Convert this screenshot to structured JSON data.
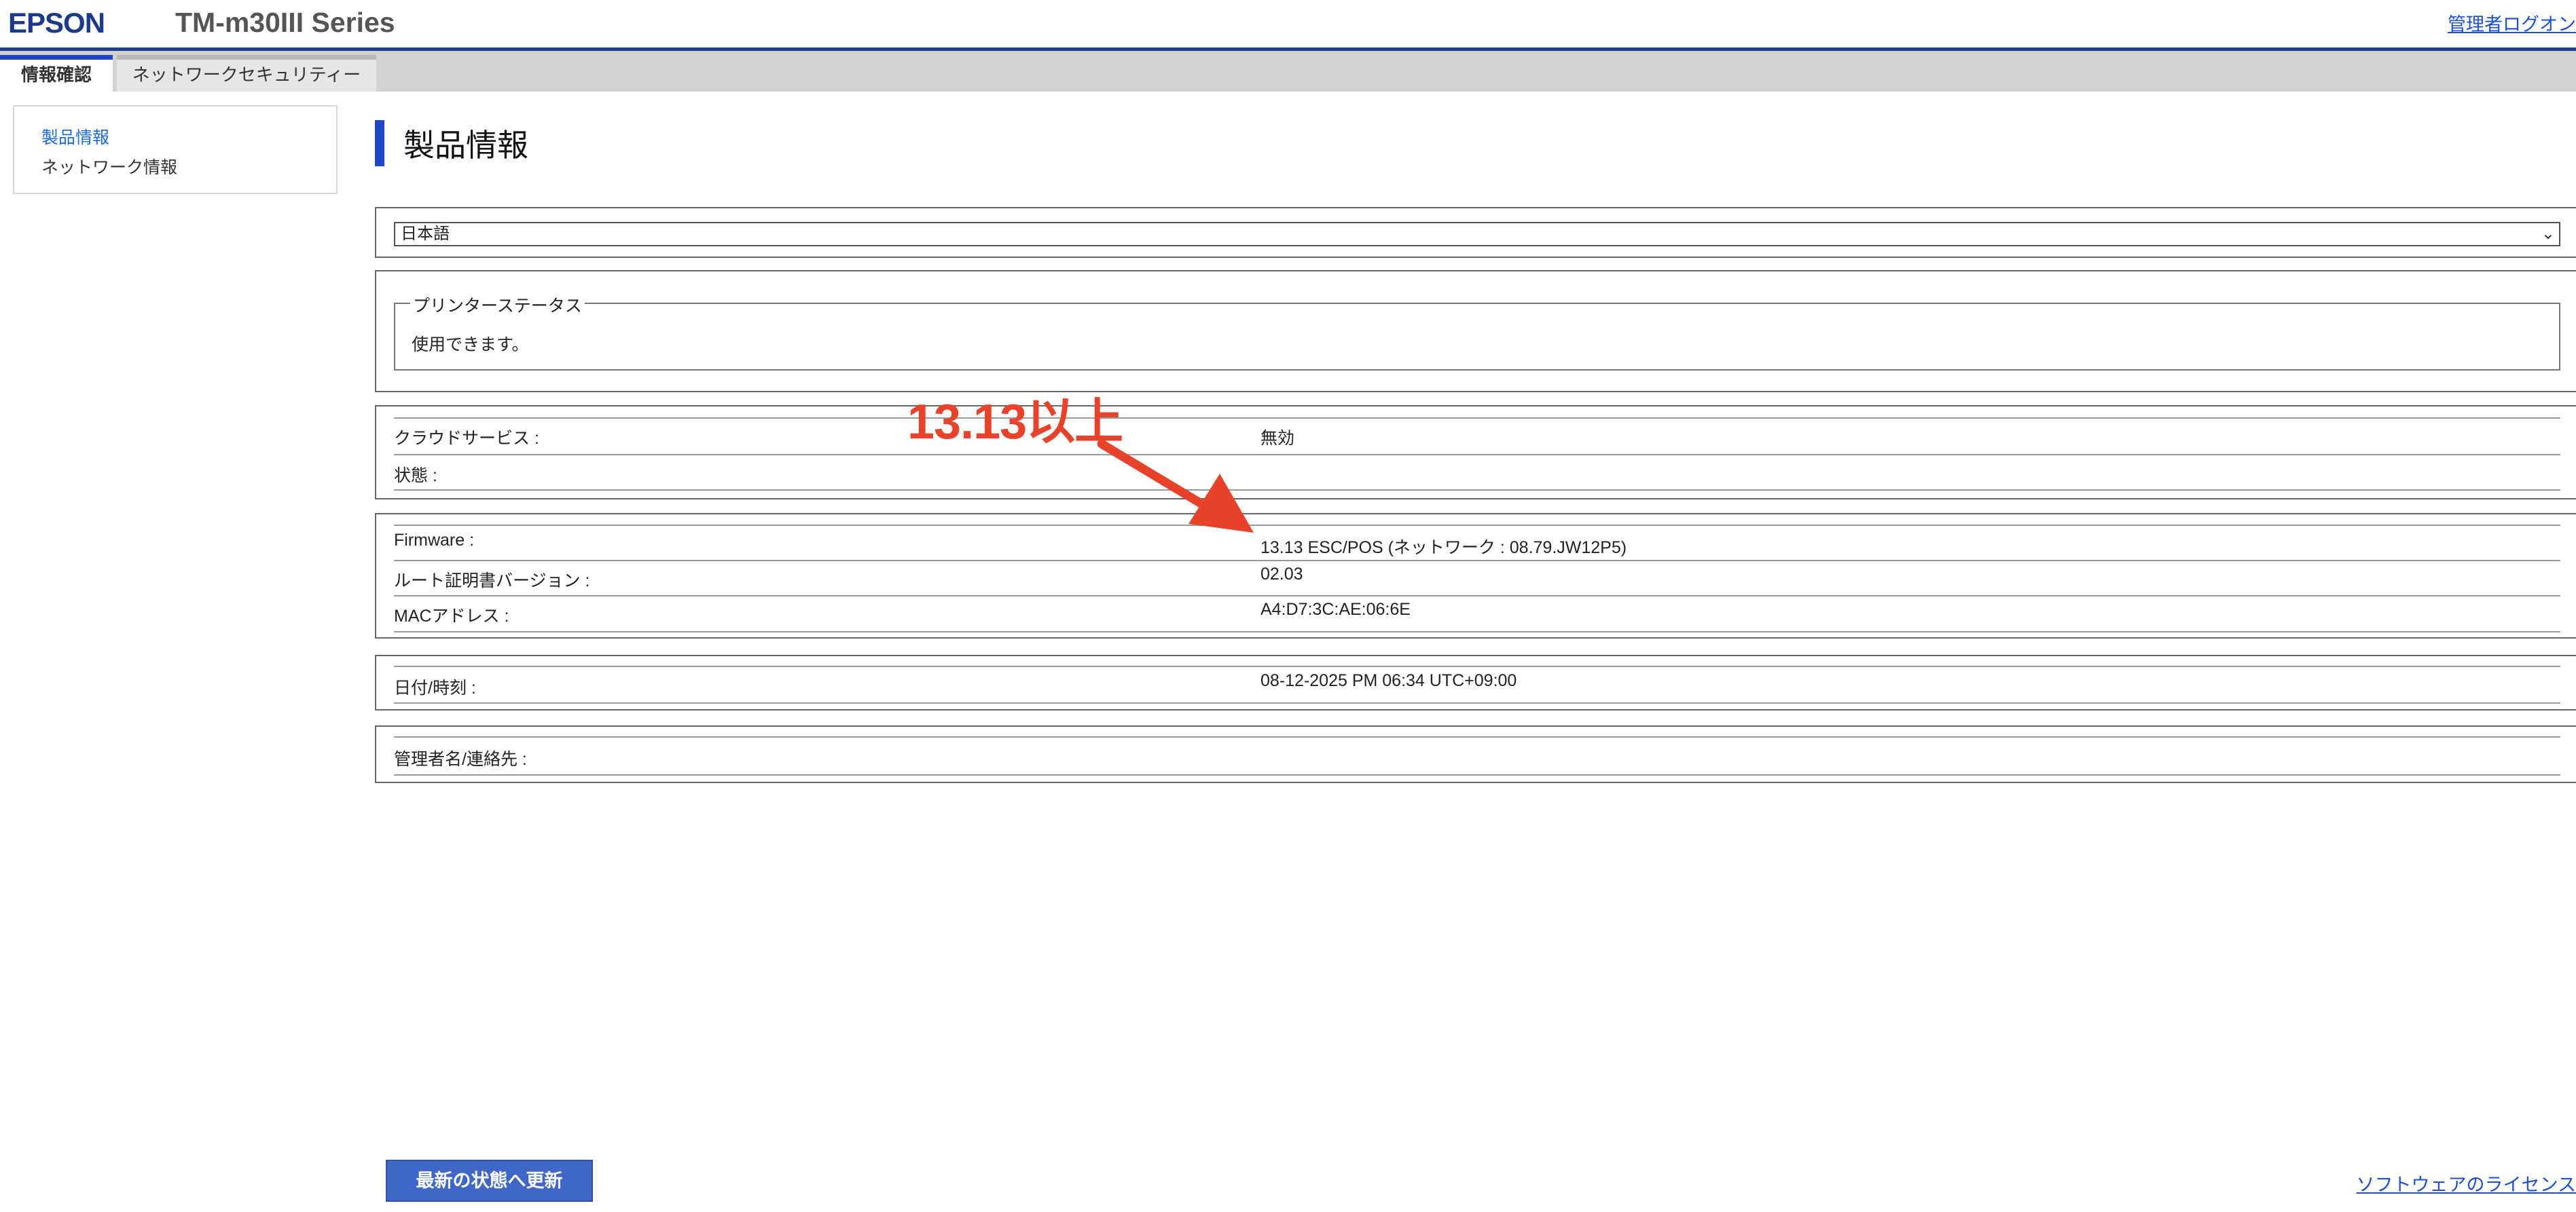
{
  "header": {
    "logo": "EPSON",
    "model": "TM-m30III Series",
    "logout_label": "管理者ログオン"
  },
  "tabs": [
    {
      "label": "情報確認",
      "active": true
    },
    {
      "label": "ネットワークセキュリティー",
      "active": false
    }
  ],
  "sidebar": {
    "items": [
      {
        "label": "製品情報",
        "active": true
      },
      {
        "label": "ネットワーク情報",
        "active": false
      }
    ]
  },
  "page": {
    "title": "製品情報",
    "language": "日本語"
  },
  "printer_status": {
    "legend": "プリンターステータス",
    "text": "使用できます。"
  },
  "cloud": {
    "rows": [
      {
        "label": "クラウドサービス :",
        "value": "無効"
      },
      {
        "label": "状態 :",
        "value": ""
      }
    ]
  },
  "device": {
    "rows": [
      {
        "label": "Firmware :",
        "value": "13.13 ESC/POS (ネットワーク : 08.79.JW12P5)"
      },
      {
        "label": "ルート証明書バージョン :",
        "value": "02.03"
      },
      {
        "label": "MACアドレス :",
        "value": "A4:D7:3C:AE:06:6E"
      }
    ]
  },
  "datetime": {
    "label": "日付/時刻 :",
    "value": "08-12-2025 PM 06:34 UTC+09:00"
  },
  "admin": {
    "label": "管理者名/連絡先 :"
  },
  "annotation": {
    "text": "13.13以上",
    "color": "#e8432a"
  },
  "footer": {
    "refresh_label": "最新の状態へ更新",
    "license_label": "ソフトウェアのライセンス"
  },
  "colors": {
    "accent": "#1f48c9",
    "link": "#1a4fd6",
    "button": "#3e67c8"
  }
}
